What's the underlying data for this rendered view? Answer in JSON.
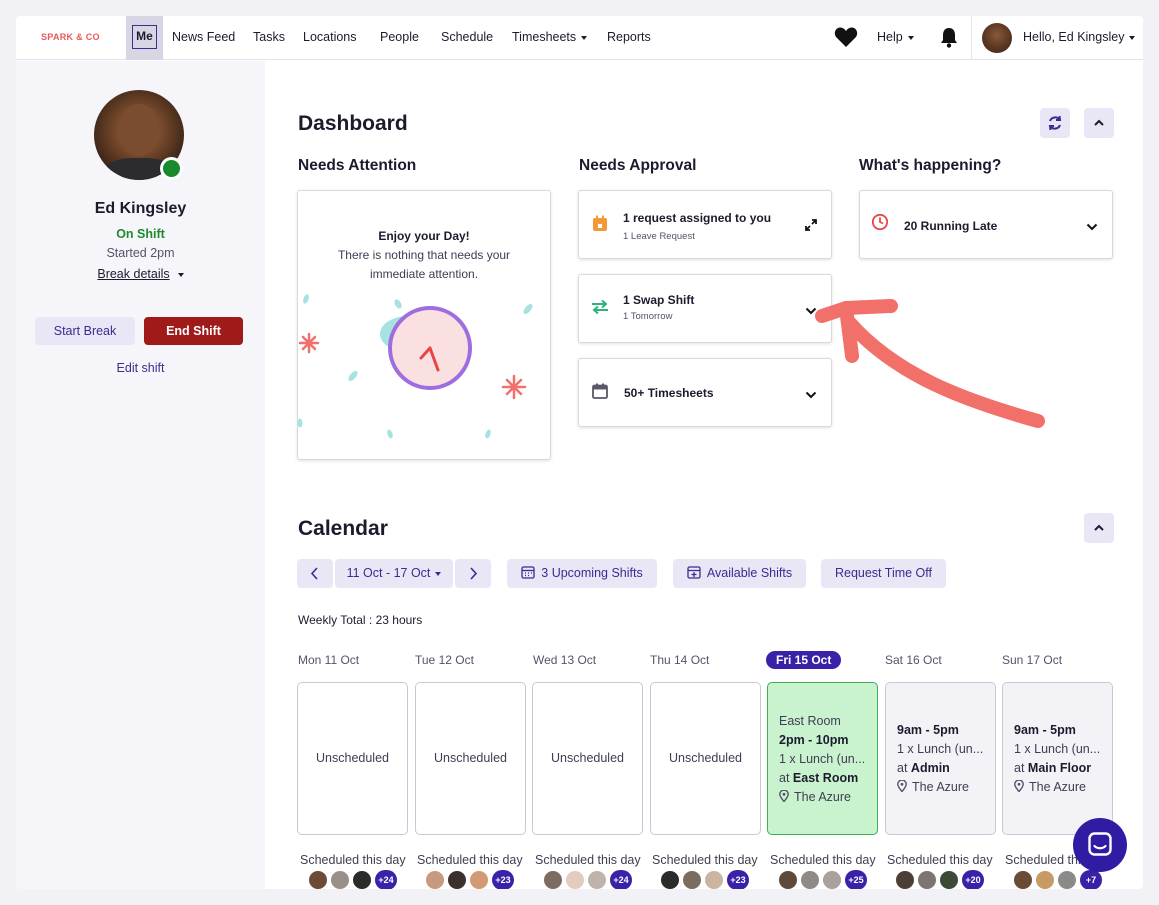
{
  "nav": {
    "brand": "SPARK & CO",
    "me": "Me",
    "items": [
      "News Feed",
      "Tasks",
      "Locations",
      "People",
      "Schedule",
      "Timesheets",
      "Reports"
    ],
    "help": "Help",
    "greeting": "Hello, Ed Kingsley"
  },
  "sidebar": {
    "name": "Ed Kingsley",
    "status": "On Shift",
    "started": "Started 2pm",
    "break_details": "Break details",
    "start_break": "Start Break",
    "end_shift": "End Shift",
    "edit_shift": "Edit shift"
  },
  "dashboard": {
    "title": "Dashboard",
    "needs_attention": {
      "heading": "Needs Attention",
      "title": "Enjoy your Day!",
      "line1": "There is nothing that needs your",
      "line2": "immediate attention."
    },
    "needs_approval": {
      "heading": "Needs Approval",
      "cards": [
        {
          "title": "1 request assigned to you",
          "sub": "1 Leave Request"
        },
        {
          "title": "1 Swap Shift",
          "sub": "1 Tomorrow"
        },
        {
          "title": "50+ Timesheets",
          "sub": ""
        }
      ]
    },
    "whats_happening": {
      "heading": "What's happening?",
      "card": {
        "title": "20 Running Late"
      }
    }
  },
  "calendar": {
    "title": "Calendar",
    "range": "11 Oct - 17 Oct",
    "upcoming": "3 Upcoming Shifts",
    "available": "Available Shifts",
    "request_off": "Request Time Off",
    "weekly_total": "Weekly Total : 23 hours",
    "scheduled_label": "Scheduled this day",
    "days": [
      {
        "label": "Mon 11 Oct",
        "text": "Unscheduled",
        "more": "+24"
      },
      {
        "label": "Tue 12 Oct",
        "text": "Unscheduled",
        "more": "+23"
      },
      {
        "label": "Wed 13 Oct",
        "text": "Unscheduled",
        "more": "+24"
      },
      {
        "label": "Thu 14 Oct",
        "text": "Unscheduled",
        "more": "+23"
      },
      {
        "label": "Fri 15 Oct",
        "room": "East Room",
        "time": "2pm - 10pm",
        "break": "1 x Lunch (un...",
        "at_prefix": "at",
        "at": "East Room",
        "place": "The Azure",
        "more": "+25"
      },
      {
        "label": "Sat 16 Oct",
        "time": "9am - 5pm",
        "break": "1 x Lunch (un...",
        "at_prefix": "at",
        "at": "Admin",
        "place": "The Azure",
        "more": "+20"
      },
      {
        "label": "Sun 17 Oct",
        "time": "9am - 5pm",
        "break": "1 x Lunch (un...",
        "at_prefix": "at",
        "at": "Main Floor",
        "place": "The Azure",
        "more": "+7"
      }
    ]
  },
  "colors": {
    "accent": "#3a21a8",
    "danger": "#a01a1a",
    "success": "#1f8a2e",
    "arrow": "#f2706a"
  }
}
